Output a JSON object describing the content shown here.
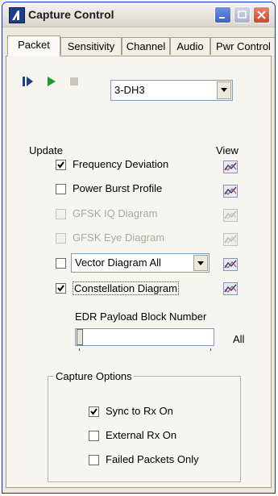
{
  "window": {
    "title": "Capture Control"
  },
  "tabs": [
    {
      "label": "Packet",
      "active": true
    },
    {
      "label": "Sensitivity",
      "active": false
    },
    {
      "label": "Channel",
      "active": false
    },
    {
      "label": "Audio",
      "active": false
    },
    {
      "label": "Pwr Control",
      "active": false
    }
  ],
  "controls": {
    "step_icon": "step-forward-icon",
    "play_icon": "play-icon",
    "stop_icon": "stop-icon",
    "packet_type": "3-DH3"
  },
  "update_label": "Update",
  "view_label": "View",
  "rows": [
    {
      "label": "Frequency Deviation",
      "checked": true,
      "enabled": true
    },
    {
      "label": "Power Burst Profile",
      "checked": false,
      "enabled": true
    },
    {
      "label": "GFSK IQ Diagram",
      "checked": false,
      "enabled": false
    },
    {
      "label": "GFSK Eye Diagram",
      "checked": false,
      "enabled": false
    },
    {
      "label": "Vector Diagram All",
      "checked": false,
      "enabled": true,
      "is_select": true
    },
    {
      "label": "Constellation Diagram",
      "checked": true,
      "enabled": true
    }
  ],
  "edr": {
    "label": "EDR Payload Block Number",
    "value_label": "All",
    "slider_position": 0
  },
  "capture_options": {
    "title": "Capture Options",
    "items": [
      {
        "label": "Sync to Rx On",
        "checked": true
      },
      {
        "label": "External Rx On",
        "checked": false
      },
      {
        "label": "Failed Packets Only",
        "checked": false
      }
    ]
  },
  "colors": {
    "accent": "#0831d9",
    "play": "#1a9b2a",
    "step": "#1d3f8a"
  }
}
